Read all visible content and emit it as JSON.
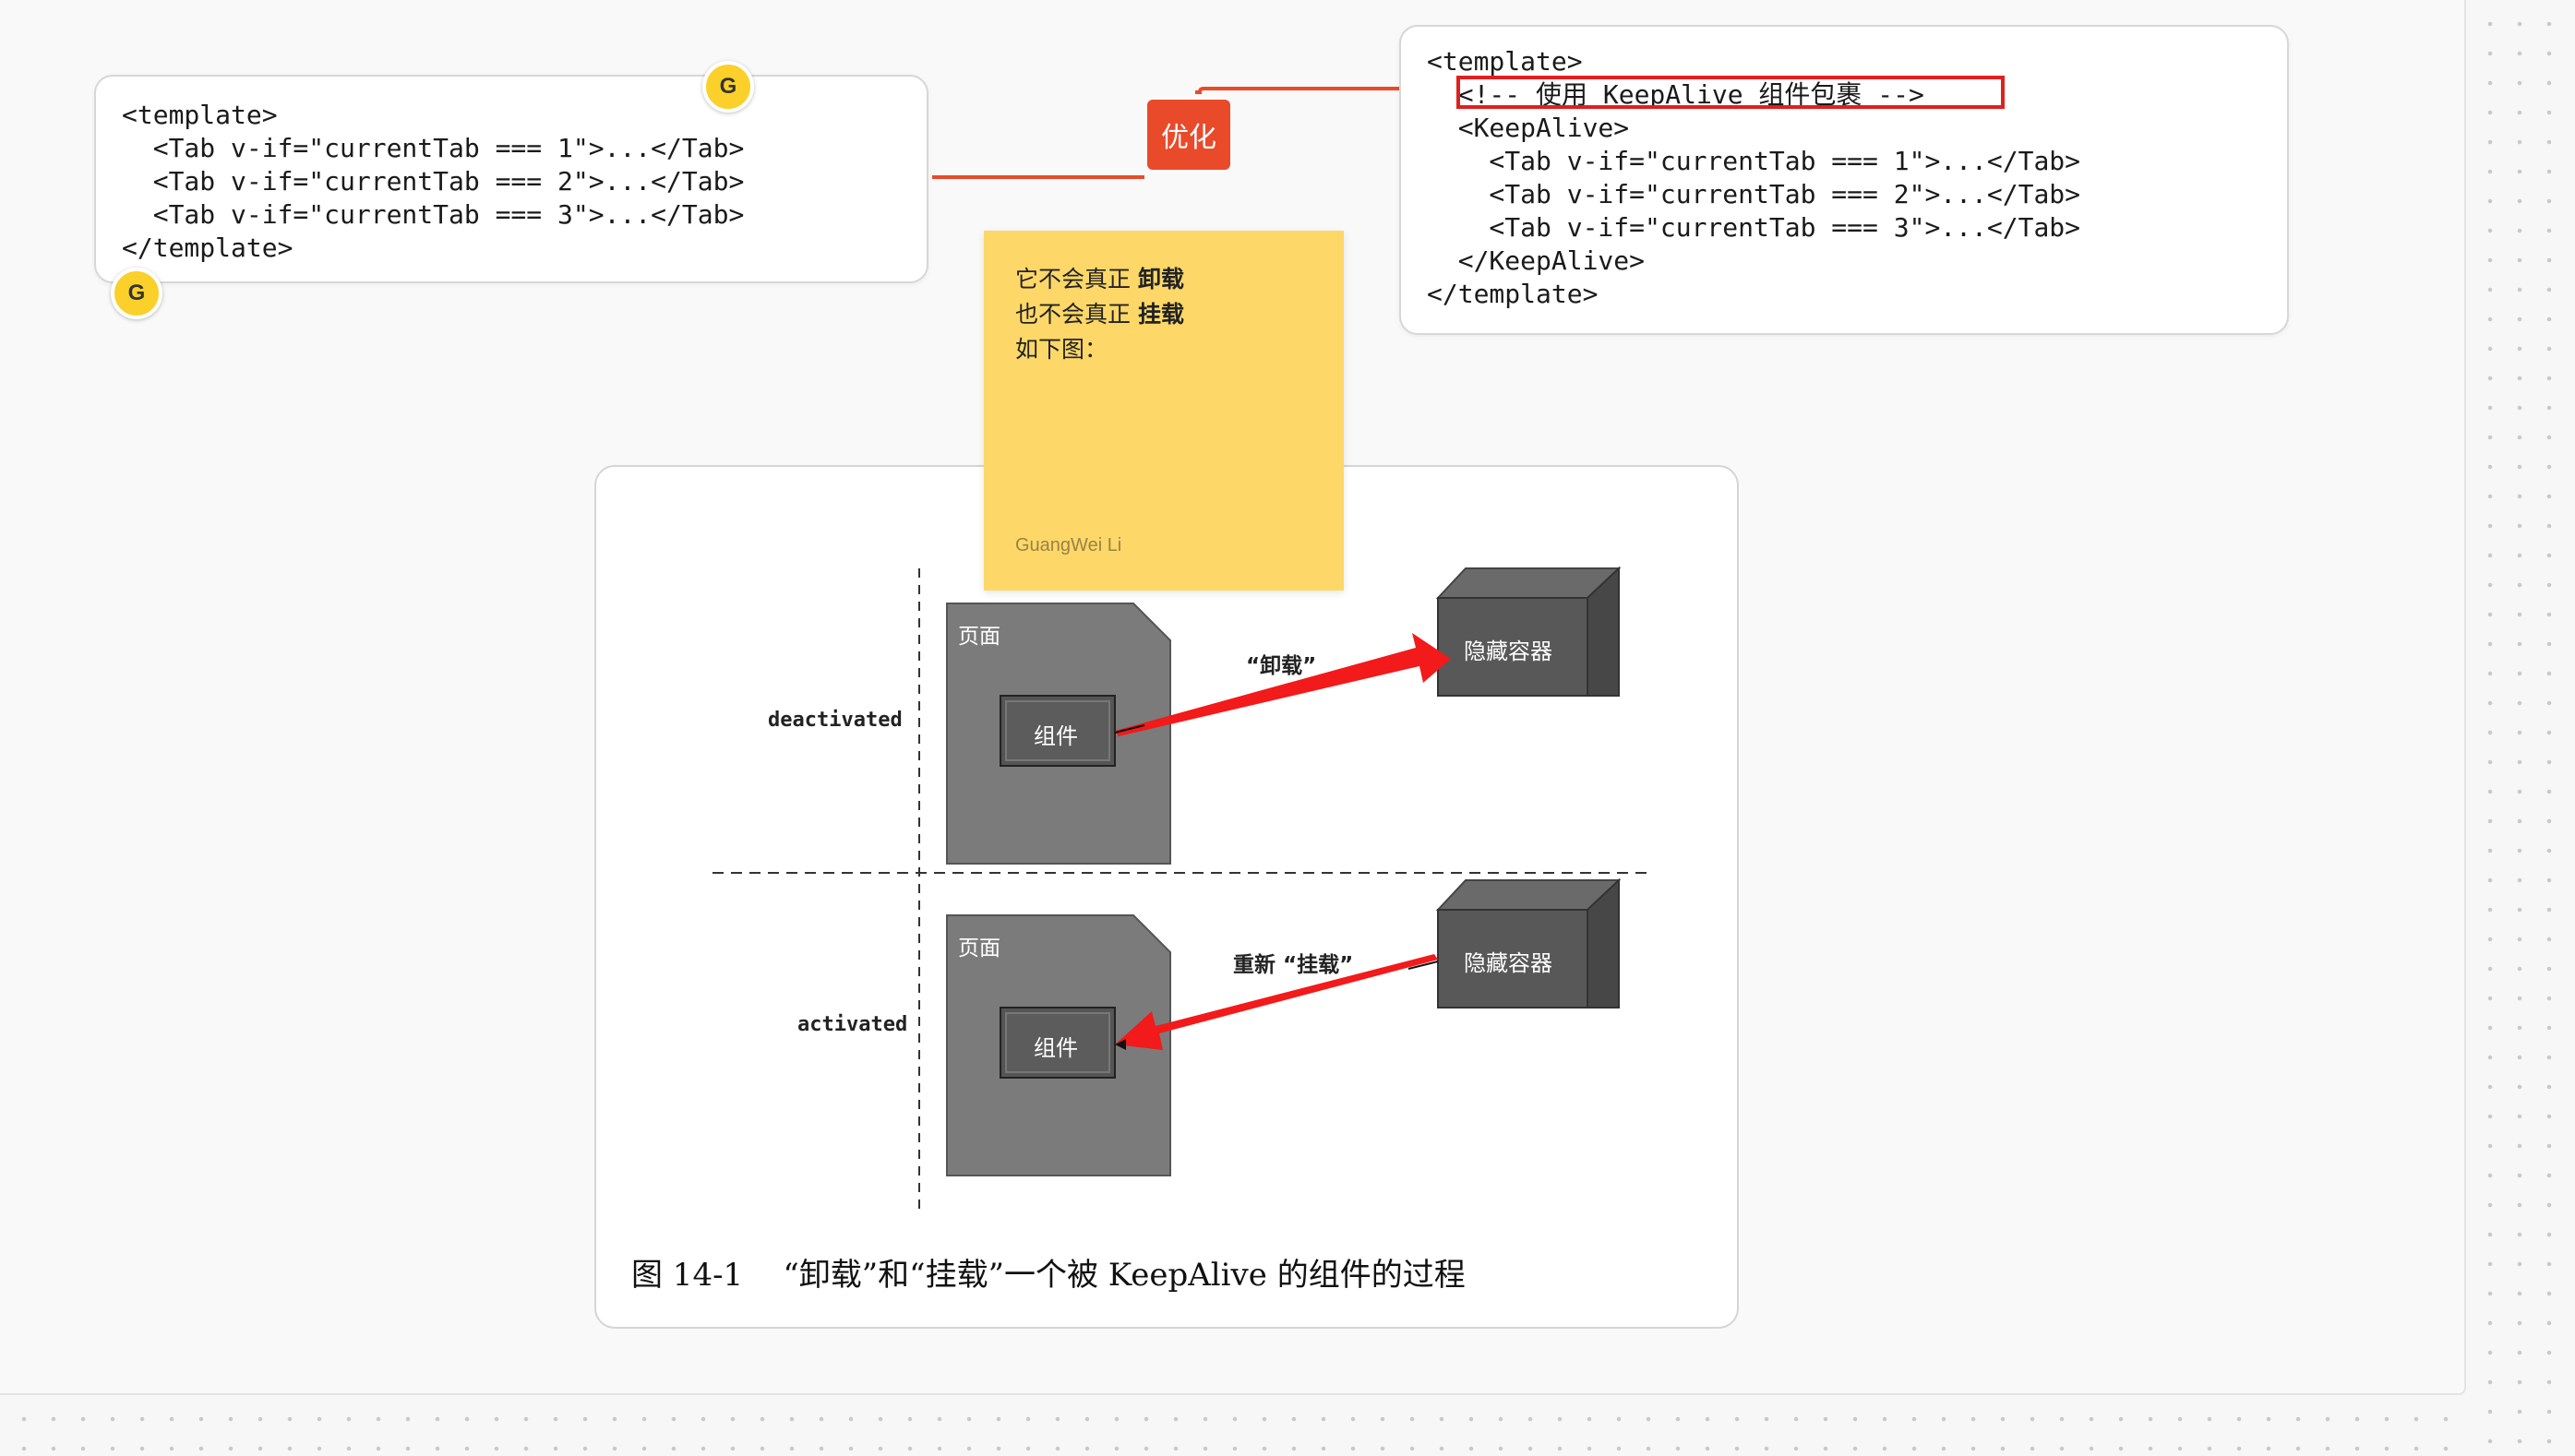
{
  "left_code": {
    "lines": [
      "<template>",
      "  <Tab v-if=\"currentTab === 1\">...</Tab>",
      "  <Tab v-if=\"currentTab === 2\">...</Tab>",
      "  <Tab v-if=\"currentTab === 3\">...</Tab>",
      "</template>"
    ]
  },
  "right_code": {
    "lines": [
      "<template>",
      "  <!-- 使用 KeepAlive 组件包裹 -->",
      "  <KeepAlive>",
      "    <Tab v-if=\"currentTab === 1\">...</Tab>",
      "    <Tab v-if=\"currentTab === 2\">...</Tab>",
      "    <Tab v-if=\"currentTab === 3\">...</Tab>",
      "  </KeepAlive>",
      "</template>"
    ]
  },
  "avatars": {
    "initial": "G"
  },
  "connector_tag": {
    "label": "优化",
    "color": "#e94a2a"
  },
  "sticky": {
    "line1_prefix": "它不会真正 ",
    "line1_bold": "卸载",
    "line2_prefix": "也不会真正 ",
    "line2_bold": "挂载",
    "line3": "如下图：",
    "author": "GuangWei Li",
    "color": "#fdd868"
  },
  "figure": {
    "row_top_label": "deactivated",
    "row_bottom_label": "activated",
    "page_label": "页面",
    "component_label": "组件",
    "container_label": "隐藏容器",
    "arrow_top_label": "“卸载”",
    "arrow_bottom_label": "重新 “挂载”",
    "caption": "图 14-1    “卸载”和“挂载”一个被 KeepAlive 的组件的过程",
    "arrow_color": "#f21a1a"
  }
}
